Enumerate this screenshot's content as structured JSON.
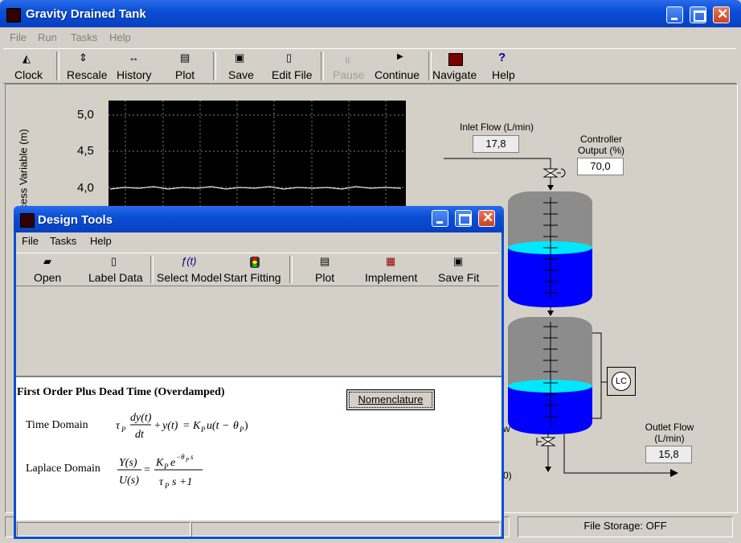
{
  "main_window": {
    "title": "Gravity Drained Tank",
    "menu": [
      "File",
      "Run",
      "Tasks",
      "Help"
    ],
    "toolbar": [
      {
        "icon": "clock-icon",
        "label": "Clock"
      },
      {
        "icon": "rescale-icon",
        "label": "Rescale"
      },
      {
        "icon": "history-icon",
        "label": "History"
      },
      {
        "icon": "printer-icon",
        "label": "Plot"
      },
      {
        "icon": "save-icon",
        "label": "Save"
      },
      {
        "icon": "document-icon",
        "label": "Edit File"
      },
      {
        "icon": "pause-icon",
        "label": "Pause"
      },
      {
        "icon": "play-icon",
        "label": "Continue"
      },
      {
        "icon": "navigate-icon",
        "label": "Navigate"
      },
      {
        "icon": "help-icon",
        "label": "Help"
      }
    ],
    "chart": {
      "y_ticks": [
        "5,0",
        "4,5",
        "4,0"
      ],
      "y_axis_label": "cess Variable (m)"
    },
    "process": {
      "inlet_flow_label": "Inlet Flow  (L/min)",
      "inlet_flow_value": "17,8",
      "controller_output_label": "Controller Output  (%)",
      "controller_output_value": "70,0",
      "outlet_flow_label": "Outlet Flow (L/min)",
      "outlet_flow_value": "15,8",
      "lc_label": "LC",
      "partial_text_1": "w",
      "partial_text_2": "0)"
    },
    "status": {
      "file_storage": "File Storage:  OFF"
    },
    "colors": {
      "title_blue": "#0a4fd6",
      "tank_gray": "#8c8c8c",
      "water_blue": "#0000ff",
      "water_cyan": "#00e8ff",
      "chart_bg": "#000000"
    }
  },
  "design_tools": {
    "title": "Design Tools",
    "menu": [
      "File",
      "Tasks",
      "Help"
    ],
    "toolbar": [
      {
        "icon": "open-folder-icon",
        "label": "Open"
      },
      {
        "icon": "document-icon",
        "label": "Label Data"
      },
      {
        "icon": "function-icon",
        "label": "Select Model"
      },
      {
        "icon": "traffic-light-icon",
        "label": "Start Fitting"
      },
      {
        "icon": "printer-icon",
        "label": "Plot"
      },
      {
        "icon": "implement-icon",
        "label": "Implement"
      },
      {
        "icon": "save-icon",
        "label": "Save Fit"
      }
    ],
    "model_title": "First Order Plus Dead Time (Overdamped)",
    "nomenclature_button": "Nomenclature",
    "time_domain_label": "Time Domain",
    "laplace_domain_label": "Laplace Domain"
  }
}
